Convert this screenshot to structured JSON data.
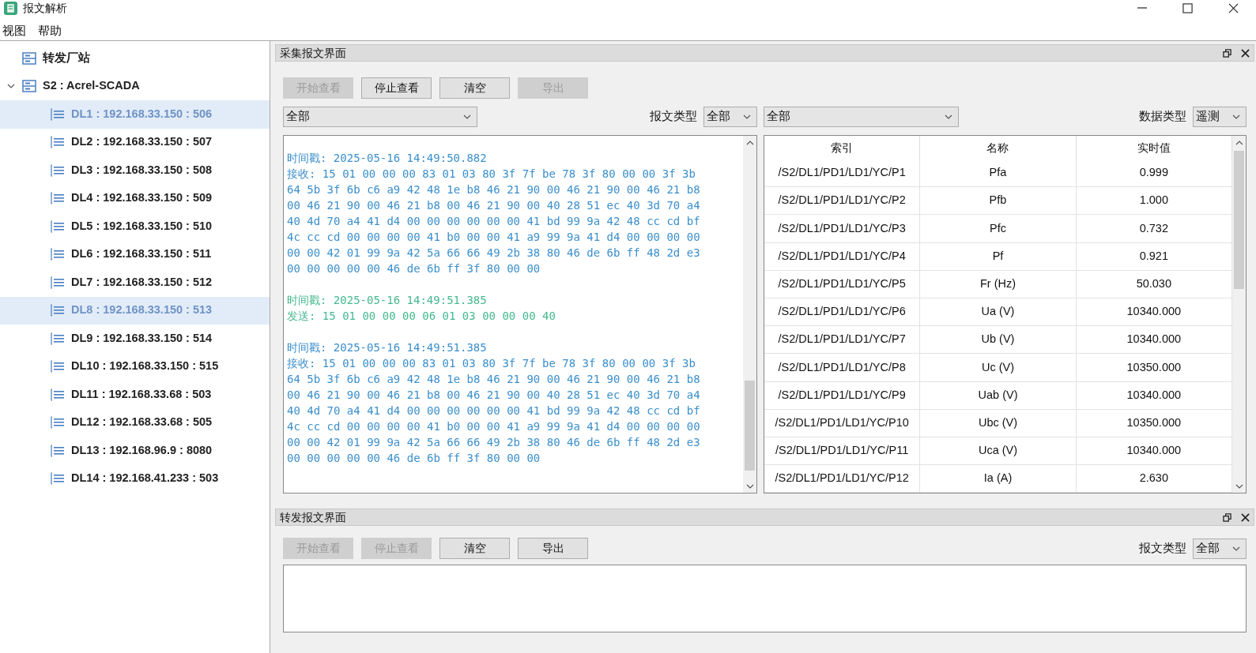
{
  "window": {
    "title": "报文解析"
  },
  "menu": [
    {
      "label": "视图"
    },
    {
      "label": "帮助"
    }
  ],
  "tree": [
    {
      "label": "转发厂站",
      "selected": false
    },
    {
      "label": "S2 : Acrel-SCADA",
      "selected": false,
      "expanded": true,
      "children": [
        {
          "label": "DL1 : 192.168.33.150 : 506",
          "selected": true
        },
        {
          "label": "DL2 : 192.168.33.150 : 507",
          "selected": false
        },
        {
          "label": "DL3 : 192.168.33.150 : 508",
          "selected": false
        },
        {
          "label": "DL4 : 192.168.33.150 : 509",
          "selected": false
        },
        {
          "label": "DL5 : 192.168.33.150 : 510",
          "selected": false
        },
        {
          "label": "DL6 : 192.168.33.150 : 511",
          "selected": false
        },
        {
          "label": "DL7 : 192.168.33.150 : 512",
          "selected": false
        },
        {
          "label": "DL8 : 192.168.33.150 : 513",
          "selected": true
        },
        {
          "label": "DL9 : 192.168.33.150 : 514",
          "selected": false
        },
        {
          "label": "DL10 : 192.168.33.150 : 515",
          "selected": false
        },
        {
          "label": "DL11 : 192.168.33.68 : 503",
          "selected": false
        },
        {
          "label": "DL12 : 192.168.33.68 : 505",
          "selected": false
        },
        {
          "label": "DL13 : 192.168.96.9 : 8080",
          "selected": false
        },
        {
          "label": "DL14 : 192.168.41.233 : 503",
          "selected": false
        }
      ]
    }
  ],
  "collect_panel": {
    "title": "采集报文界面",
    "buttons": [
      {
        "label": "开始查看",
        "disabled": true
      },
      {
        "label": "停止查看",
        "disabled": false
      },
      {
        "label": "清空",
        "disabled": false
      },
      {
        "label": "导出",
        "disabled": true
      }
    ],
    "filter_left": {
      "value": "全部"
    },
    "message_type": {
      "label": "报文类型",
      "value": "全部"
    },
    "filter_right": {
      "value": "全部"
    },
    "data_type": {
      "label": "数据类型",
      "value": "遥测"
    },
    "log": [
      {
        "kind": "receive",
        "timestamp": "时间戳: 2025-05-16 14:49:50.882",
        "lines": [
          "接收: 15 01 00 00 00 83 01 03 80 3f 7f be 78 3f 80 00 00 3f 3b",
          "64 5b 3f 6b c6 a9 42 48 1e b8 46 21 90 00 46 21 90 00 46 21 b8",
          "00 46 21 90 00 46 21 b8 00 46 21 90 00 40 28 51 ec 40 3d 70 a4",
          "40 4d 70 a4 41 d4 00 00 00 00 00 00 41 bd 99 9a 42 48 cc cd bf",
          "4c cc cd 00 00 00 00 41 b0 00 00 41 a9 99 9a 41 d4 00 00 00 00",
          "00 00 42 01 99 9a 42 5a 66 66 49 2b 38 80 46 de 6b ff 48 2d e3",
          "00 00 00 00 00 46 de 6b ff 3f 80 00 00"
        ]
      },
      {
        "kind": "send",
        "timestamp": "时间戳: 2025-05-16 14:49:51.385",
        "lines": [
          "发送: 15 01 00 00 00 06 01 03 00 00 00 40"
        ]
      },
      {
        "kind": "receive",
        "timestamp": "时间戳: 2025-05-16 14:49:51.385",
        "lines": [
          "接收: 15 01 00 00 00 83 01 03 80 3f 7f be 78 3f 80 00 00 3f 3b",
          "64 5b 3f 6b c6 a9 42 48 1e b8 46 21 90 00 46 21 90 00 46 21 b8",
          "00 46 21 90 00 46 21 b8 00 46 21 90 00 40 28 51 ec 40 3d 70 a4",
          "40 4d 70 a4 41 d4 00 00 00 00 00 00 41 bd 99 9a 42 48 cc cd bf",
          "4c cc cd 00 00 00 00 41 b0 00 00 41 a9 99 9a 41 d4 00 00 00 00",
          "00 00 42 01 99 9a 42 5a 66 66 49 2b 38 80 46 de 6b ff 48 2d e3",
          "00 00 00 00 00 46 de 6b ff 3f 80 00 00"
        ]
      }
    ],
    "table": {
      "columns": [
        "索引",
        "名称",
        "实时值"
      ],
      "rows": [
        [
          "/S2/DL1/PD1/LD1/YC/P1",
          "Pfa",
          "0.999"
        ],
        [
          "/S2/DL1/PD1/LD1/YC/P2",
          "Pfb",
          "1.000"
        ],
        [
          "/S2/DL1/PD1/LD1/YC/P3",
          "Pfc",
          "0.732"
        ],
        [
          "/S2/DL1/PD1/LD1/YC/P4",
          "Pf",
          "0.921"
        ],
        [
          "/S2/DL1/PD1/LD1/YC/P5",
          "Fr (Hz)",
          "50.030"
        ],
        [
          "/S2/DL1/PD1/LD1/YC/P6",
          "Ua (V)",
          "10340.000"
        ],
        [
          "/S2/DL1/PD1/LD1/YC/P7",
          "Ub (V)",
          "10340.000"
        ],
        [
          "/S2/DL1/PD1/LD1/YC/P8",
          "Uc (V)",
          "10350.000"
        ],
        [
          "/S2/DL1/PD1/LD1/YC/P9",
          "Uab (V)",
          "10340.000"
        ],
        [
          "/S2/DL1/PD1/LD1/YC/P10",
          "Ubc (V)",
          "10350.000"
        ],
        [
          "/S2/DL1/PD1/LD1/YC/P11",
          "Uca (V)",
          "10340.000"
        ],
        [
          "/S2/DL1/PD1/LD1/YC/P12",
          "Ia (A)",
          "2.630"
        ]
      ]
    }
  },
  "forward_panel": {
    "title": "转发报文界面",
    "buttons": [
      {
        "label": "开始查看",
        "disabled": true
      },
      {
        "label": "停止查看",
        "disabled": true
      },
      {
        "label": "清空",
        "disabled": false
      },
      {
        "label": "导出",
        "disabled": false
      }
    ],
    "message_type": {
      "label": "报文类型",
      "value": "全部"
    }
  }
}
